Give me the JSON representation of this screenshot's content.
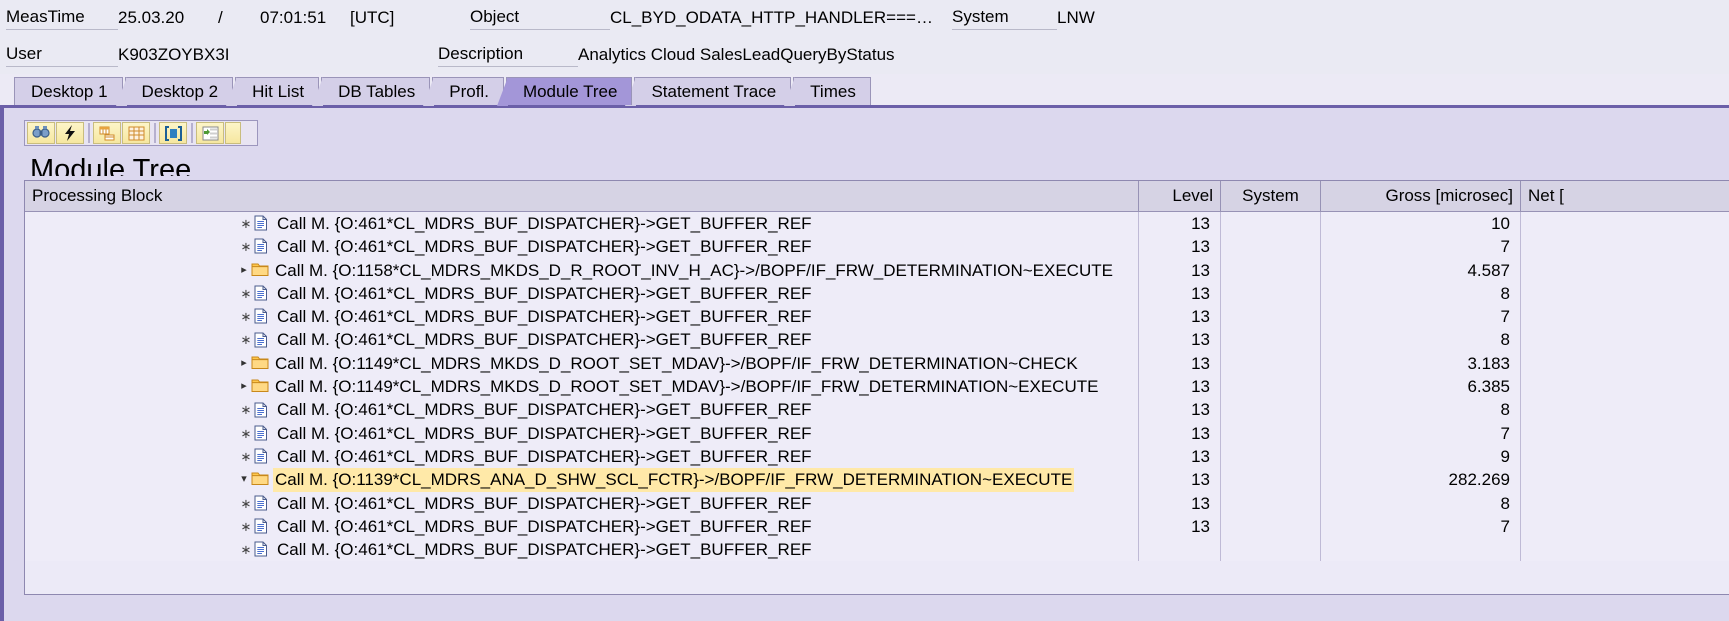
{
  "header": {
    "meastime_label": "MeasTime",
    "meastime_date": "25.03.20",
    "separator": "/",
    "meastime_time": "07:01:51",
    "timezone": "[UTC]",
    "object_label": "Object",
    "object_value": "CL_BYD_ODATA_HTTP_HANDLER===…",
    "system_label": "System",
    "system_value": "LNW",
    "user_label": "User",
    "user_value": "K903ZOYBX3I",
    "description_label": "Description",
    "description_value": "Analytics Cloud SalesLeadQueryByStatus"
  },
  "tabs": [
    {
      "label": "Desktop 1",
      "active": false
    },
    {
      "label": "Desktop 2",
      "active": false
    },
    {
      "label": "Hit List",
      "active": false
    },
    {
      "label": "DB Tables",
      "active": false
    },
    {
      "label": "Profl.",
      "active": false
    },
    {
      "label": "Module Tree",
      "active": true
    },
    {
      "label": "Statement Trace",
      "active": false
    },
    {
      "label": "Times",
      "active": false
    }
  ],
  "toolbar": {
    "buttons": [
      {
        "name": "find-icon",
        "title": "Find"
      },
      {
        "name": "lightning-icon",
        "title": "Execute"
      },
      {
        "name": "table-layout-icon",
        "title": "Layout"
      },
      {
        "name": "grid-icon",
        "title": "Grid"
      },
      {
        "name": "select-block-icon",
        "title": "Select"
      },
      {
        "name": "tree-hierarchy-icon",
        "title": "Hierarchy"
      }
    ]
  },
  "section_title": "Module Tree",
  "grid": {
    "columns": [
      {
        "key": "block",
        "label": "Processing Block"
      },
      {
        "key": "level",
        "label": "Level"
      },
      {
        "key": "system",
        "label": "System"
      },
      {
        "key": "gross",
        "label": "Gross [microsec]"
      },
      {
        "key": "net",
        "label": "Net ["
      }
    ],
    "rows": [
      {
        "icon": "document-icon",
        "twisty": "dot",
        "text": "Call M. {O:461*CL_MDRS_BUF_DISPATCHER}->GET_BUFFER_REF",
        "level": "13",
        "system": "",
        "gross": "10",
        "net": "",
        "highlight": false
      },
      {
        "icon": "document-icon",
        "twisty": "dot",
        "text": "Call M. {O:461*CL_MDRS_BUF_DISPATCHER}->GET_BUFFER_REF",
        "level": "13",
        "system": "",
        "gross": "7",
        "net": "",
        "highlight": false
      },
      {
        "icon": "folder-icon",
        "twisty": "collapsed",
        "text": "Call M. {O:1158*CL_MDRS_MKDS_D_R_ROOT_INV_H_AC}->/BOPF/IF_FRW_DETERMINATION~EXECUTE",
        "level": "13",
        "system": "",
        "gross": "4.587",
        "net": "",
        "highlight": false
      },
      {
        "icon": "document-icon",
        "twisty": "dot",
        "text": "Call M. {O:461*CL_MDRS_BUF_DISPATCHER}->GET_BUFFER_REF",
        "level": "13",
        "system": "",
        "gross": "8",
        "net": "",
        "highlight": false
      },
      {
        "icon": "document-icon",
        "twisty": "dot",
        "text": "Call M. {O:461*CL_MDRS_BUF_DISPATCHER}->GET_BUFFER_REF",
        "level": "13",
        "system": "",
        "gross": "7",
        "net": "",
        "highlight": false
      },
      {
        "icon": "document-icon",
        "twisty": "dot",
        "text": "Call M. {O:461*CL_MDRS_BUF_DISPATCHER}->GET_BUFFER_REF",
        "level": "13",
        "system": "",
        "gross": "8",
        "net": "",
        "highlight": false
      },
      {
        "icon": "folder-icon",
        "twisty": "collapsed",
        "text": "Call M. {O:1149*CL_MDRS_MKDS_D_ROOT_SET_MDAV}->/BOPF/IF_FRW_DETERMINATION~CHECK",
        "level": "13",
        "system": "",
        "gross": "3.183",
        "net": "",
        "highlight": false
      },
      {
        "icon": "folder-icon",
        "twisty": "collapsed",
        "text": "Call M. {O:1149*CL_MDRS_MKDS_D_ROOT_SET_MDAV}->/BOPF/IF_FRW_DETERMINATION~EXECUTE",
        "level": "13",
        "system": "",
        "gross": "6.385",
        "net": "",
        "highlight": false
      },
      {
        "icon": "document-icon",
        "twisty": "dot",
        "text": "Call M. {O:461*CL_MDRS_BUF_DISPATCHER}->GET_BUFFER_REF",
        "level": "13",
        "system": "",
        "gross": "8",
        "net": "",
        "highlight": false
      },
      {
        "icon": "document-icon",
        "twisty": "dot",
        "text": "Call M. {O:461*CL_MDRS_BUF_DISPATCHER}->GET_BUFFER_REF",
        "level": "13",
        "system": "",
        "gross": "7",
        "net": "",
        "highlight": false
      },
      {
        "icon": "document-icon",
        "twisty": "dot",
        "text": "Call M. {O:461*CL_MDRS_BUF_DISPATCHER}->GET_BUFFER_REF",
        "level": "13",
        "system": "",
        "gross": "9",
        "net": "",
        "highlight": false
      },
      {
        "icon": "folder-icon",
        "twisty": "expanded",
        "text": "Call M. {O:1139*CL_MDRS_ANA_D_SHW_SCL_FCTR}->/BOPF/IF_FRW_DETERMINATION~EXECUTE",
        "level": "13",
        "system": "",
        "gross": "282.269",
        "net": "",
        "highlight": true
      },
      {
        "icon": "document-icon",
        "twisty": "dot",
        "text": "Call M. {O:461*CL_MDRS_BUF_DISPATCHER}->GET_BUFFER_REF",
        "level": "13",
        "system": "",
        "gross": "8",
        "net": "",
        "highlight": false
      },
      {
        "icon": "document-icon",
        "twisty": "dot",
        "text": "Call M. {O:461*CL_MDRS_BUF_DISPATCHER}->GET_BUFFER_REF",
        "level": "13",
        "system": "",
        "gross": "7",
        "net": "",
        "highlight": false
      },
      {
        "icon": "document-icon",
        "twisty": "dot",
        "text": "Call M. {O:461*CL_MDRS_BUF_DISPATCHER}->GET_BUFFER_REF",
        "level": "",
        "system": "",
        "gross": "",
        "net": "",
        "highlight": false
      }
    ]
  },
  "colors": {
    "accent": "#6b5fa8",
    "tab_active": "#a396d8",
    "tab_inactive": "#d4cfe8",
    "highlight": "#ffe9a8",
    "panel": "#dcd8ee"
  }
}
